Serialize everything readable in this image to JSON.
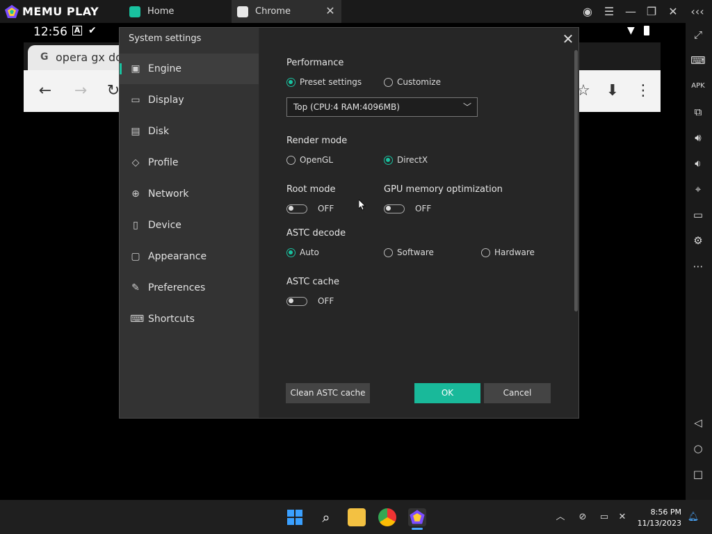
{
  "app": {
    "brand": "MEMU PLAY"
  },
  "tabs": [
    {
      "label": "Home"
    },
    {
      "label": "Chrome"
    }
  ],
  "android": {
    "clock": "12:56",
    "chrome_tab_title": "opera gx do"
  },
  "dialog": {
    "title": "System settings",
    "nav": [
      {
        "label": "Engine",
        "icon": "chip-icon"
      },
      {
        "label": "Display",
        "icon": "monitor-icon"
      },
      {
        "label": "Disk",
        "icon": "disk-icon"
      },
      {
        "label": "Profile",
        "icon": "tag-icon"
      },
      {
        "label": "Network",
        "icon": "globe-icon"
      },
      {
        "label": "Device",
        "icon": "phone-icon"
      },
      {
        "label": "Appearance",
        "icon": "window-icon"
      },
      {
        "label": "Preferences",
        "icon": "wrench-icon"
      },
      {
        "label": "Shortcuts",
        "icon": "keyboard-icon"
      }
    ],
    "active_nav": "Engine",
    "performance": {
      "title": "Performance",
      "preset_label": "Preset settings",
      "customize_label": "Customize",
      "selected": "Preset settings",
      "select_value": "Top (CPU:4 RAM:4096MB)"
    },
    "render_mode": {
      "title": "Render mode",
      "opengl_label": "OpenGL",
      "directx_label": "DirectX",
      "selected": "DirectX"
    },
    "root_mode": {
      "title": "Root mode",
      "state": "OFF"
    },
    "gpu_mem": {
      "title": "GPU memory optimization",
      "state": "OFF"
    },
    "astc_decode": {
      "title": "ASTC decode",
      "auto_label": "Auto",
      "software_label": "Software",
      "hardware_label": "Hardware",
      "selected": "Auto"
    },
    "astc_cache": {
      "title": "ASTC cache",
      "state": "OFF"
    },
    "buttons": {
      "clean": "Clean ASTC cache",
      "ok": "OK",
      "cancel": "Cancel"
    }
  },
  "taskbar": {
    "time": "8:56 PM",
    "date": "11/13/2023"
  },
  "colors": {
    "accent": "#19c2a0",
    "ok_button": "#19b99a",
    "dialog_bg": "#262626",
    "sidebar_bg": "#333333"
  }
}
